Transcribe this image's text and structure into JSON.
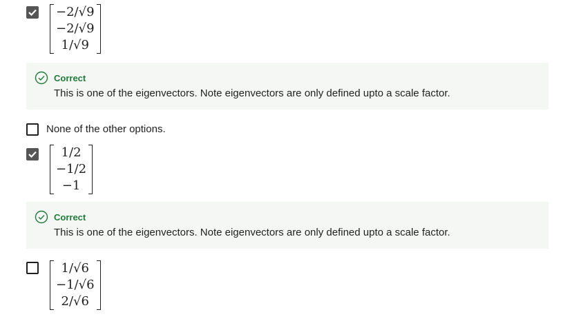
{
  "options": [
    {
      "checked": true,
      "matrix": [
        "−2/√9",
        "−2/√9",
        "1/√9"
      ]
    },
    {
      "checked": false,
      "label": "None of the other options."
    },
    {
      "checked": true,
      "matrix": [
        "1/2",
        "−1/2",
        "−1"
      ]
    },
    {
      "checked": false,
      "matrix": [
        "1/√6",
        "−1/√6",
        "2/√6"
      ]
    }
  ],
  "feedback": [
    {
      "title": "Correct",
      "text": "This is one of the eigenvectors. Note eigenvectors are only defined upto a scale factor."
    },
    {
      "title": "Correct",
      "text": "This is one of the eigenvectors. Note eigenvectors are only defined upto a scale factor."
    }
  ],
  "colors": {
    "correct_green": "#1f7a3a",
    "feedback_bg": "#f5f7f5",
    "checkbox_checked": "#555555"
  }
}
